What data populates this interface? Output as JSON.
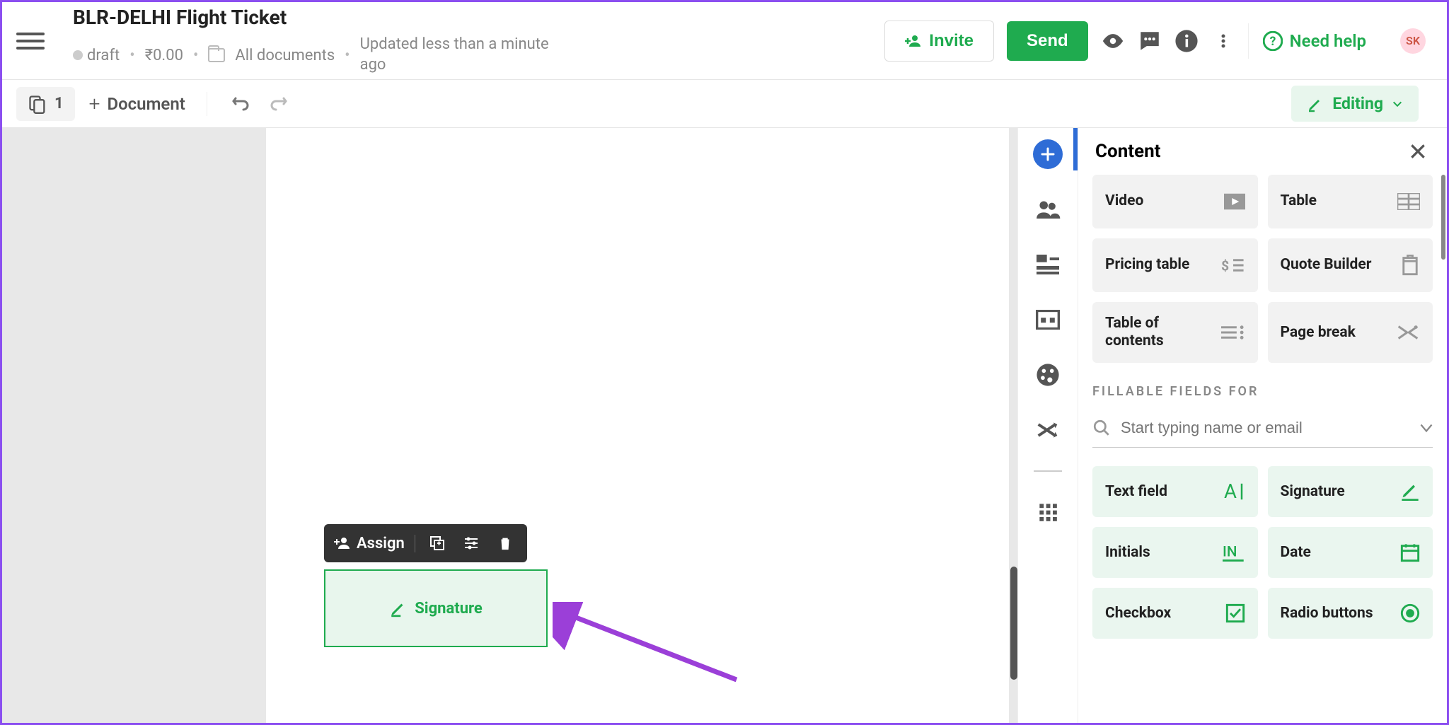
{
  "header": {
    "title": "BLR-DELHI Flight Ticket",
    "status": "draft",
    "price": "₹0.00",
    "folder": "All documents",
    "updated": "Updated less than a minute ago",
    "invite": "Invite",
    "send": "Send",
    "help": "Need help",
    "avatar": "SK"
  },
  "toolbar": {
    "page_count": "1",
    "document": "Document",
    "editing": "Editing"
  },
  "block": {
    "assign": "Assign",
    "signature": "Signature"
  },
  "panel": {
    "title": "Content",
    "section": "FILLABLE FIELDS FOR",
    "search_placeholder": "Start typing name or email",
    "tiles": {
      "video": "Video",
      "table": "Table",
      "pricing": "Pricing table",
      "quote": "Quote Builder",
      "toc": "Table of contents",
      "pagebreak": "Page break"
    },
    "fields": {
      "text": "Text field",
      "signature": "Signature",
      "initials": "Initials",
      "date": "Date",
      "checkbox": "Checkbox",
      "radio": "Radio buttons"
    }
  }
}
